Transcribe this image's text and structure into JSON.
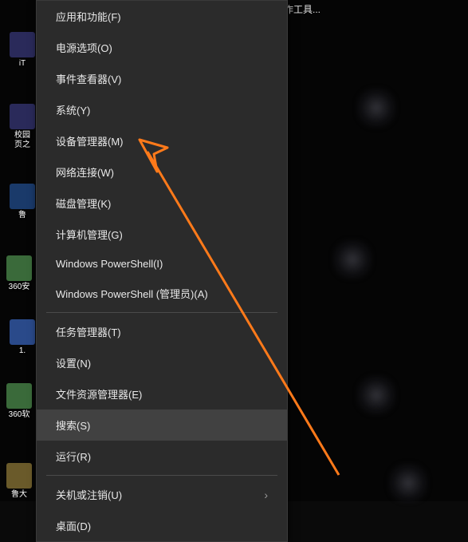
{
  "top_partial_text": "作工具...",
  "context_menu": {
    "groups": [
      [
        "应用和功能(F)",
        "电源选项(O)",
        "事件查看器(V)",
        "系统(Y)",
        "设备管理器(M)",
        "网络连接(W)",
        "磁盘管理(K)",
        "计算机管理(G)",
        "Windows PowerShell(I)",
        "Windows PowerShell (管理员)(A)"
      ],
      [
        "任务管理器(T)",
        "设置(N)",
        "文件资源管理器(E)",
        "搜索(S)",
        "运行(R)"
      ],
      [
        "关机或注销(U)",
        "桌面(D)"
      ]
    ],
    "submenu_items": [
      "关机或注销(U)"
    ],
    "hovered": "搜索(S)"
  },
  "desktop_icons": {
    "left_column": [
      "iT",
      "校园",
      "页之",
      "鲁",
      "360安",
      "1.",
      "360软",
      "鲁大"
    ]
  },
  "annotation": {
    "type": "arrow",
    "color": "#ff7a1a",
    "points_to": "设备管理器(M)"
  }
}
